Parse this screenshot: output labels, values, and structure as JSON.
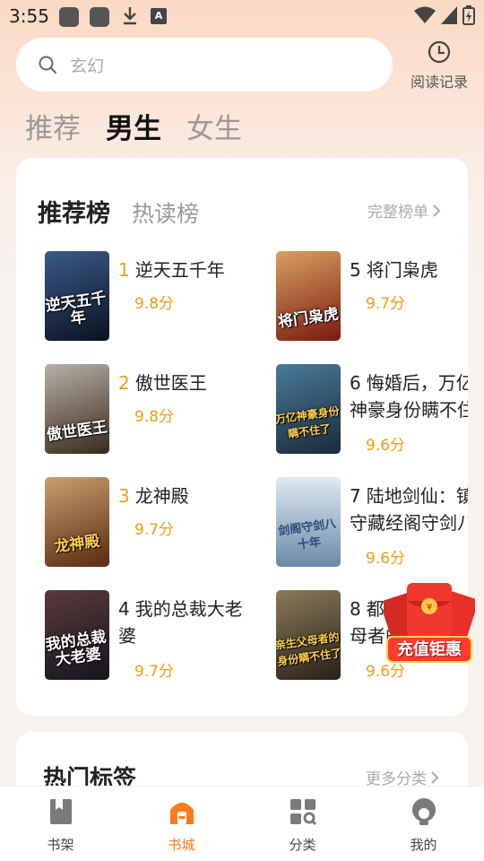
{
  "status_bar": {
    "time": "3:55",
    "notification_letter": "A"
  },
  "search": {
    "placeholder": "玄幻"
  },
  "history": {
    "label": "阅读记录"
  },
  "gender_tabs": [
    {
      "label": "推荐",
      "active": false
    },
    {
      "label": "男生",
      "active": true
    },
    {
      "label": "女生",
      "active": false
    }
  ],
  "ranking": {
    "tabs": [
      {
        "label": "推荐榜",
        "active": true
      },
      {
        "label": "热读榜",
        "active": false
      }
    ],
    "full_list_label": "完整榜单",
    "books": [
      {
        "rank": "1",
        "title": "逆天五千年",
        "score": "9.8分",
        "cover_text": "逆天五千年",
        "cover_color": "#1a2a44"
      },
      {
        "rank": "2",
        "title": "傲世医王",
        "score": "9.8分",
        "cover_text": "傲世医王",
        "cover_color": "#5a4a3a"
      },
      {
        "rank": "3",
        "title": "龙神殿",
        "score": "9.7分",
        "cover_text": "龙神殿",
        "cover_color": "#6a3a1a"
      },
      {
        "rank": "4",
        "title": "我的总裁大老婆",
        "score": "9.7分",
        "cover_text": "我的总裁大老婆",
        "cover_color": "#2a2a3a"
      },
      {
        "rank": "5",
        "title": "将门枭虎",
        "score": "9.7分",
        "cover_text": "将门枭虎",
        "cover_color": "#8a3020"
      },
      {
        "rank": "6",
        "title": "悔婚后，万亿神豪身份瞒不住了",
        "score": "9.6分",
        "cover_text": "万亿神豪身份瞒不住了",
        "cover_color": "#2a4a5a"
      },
      {
        "rank": "7",
        "title": "陆地剑仙：镇守藏经阁守剑八十年",
        "score": "9.6分",
        "cover_text": "剑阁守剑八十年",
        "cover_color": "#7a9ab0"
      },
      {
        "rank": "8",
        "title": "都市：亲生父母者的身份瞒不住了",
        "score": "9.6分",
        "cover_text": "亲生父母者的身份瞒不住了",
        "cover_color": "#3a3028"
      }
    ]
  },
  "hot_tags": {
    "title": "热门标签",
    "more_label": "更多分类"
  },
  "red_packet": {
    "label": "充值钜惠"
  },
  "bottom_nav": [
    {
      "label": "书架",
      "icon": "bookshelf-icon",
      "active": false
    },
    {
      "label": "书城",
      "icon": "bookstore-icon",
      "active": true
    },
    {
      "label": "分类",
      "icon": "category-icon",
      "active": false
    },
    {
      "label": "我的",
      "icon": "profile-icon",
      "active": false
    }
  ],
  "colors": {
    "accent": "#ff7a1a",
    "score": "#f39c12",
    "rank_highlight": "#f39c12"
  }
}
